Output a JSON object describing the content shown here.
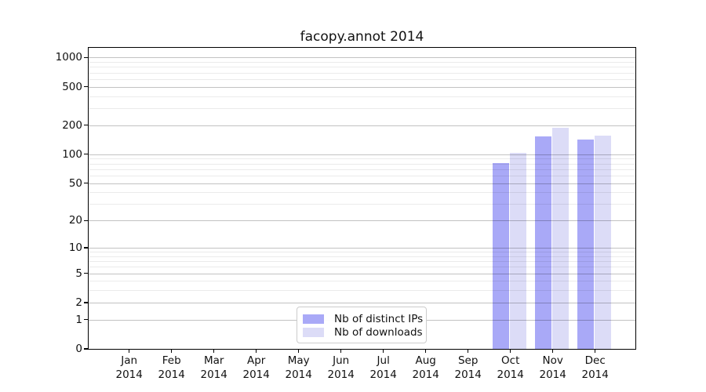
{
  "chart_data": {
    "type": "bar",
    "title": "facopy.annot 2014",
    "x_axis": {
      "categories": [
        {
          "month": "Jan",
          "year": "2014"
        },
        {
          "month": "Feb",
          "year": "2014"
        },
        {
          "month": "Mar",
          "year": "2014"
        },
        {
          "month": "Apr",
          "year": "2014"
        },
        {
          "month": "May",
          "year": "2014"
        },
        {
          "month": "Jun",
          "year": "2014"
        },
        {
          "month": "Jul",
          "year": "2014"
        },
        {
          "month": "Aug",
          "year": "2014"
        },
        {
          "month": "Sep",
          "year": "2014"
        },
        {
          "month": "Oct",
          "year": "2014"
        },
        {
          "month": "Nov",
          "year": "2014"
        },
        {
          "month": "Dec",
          "year": "2014"
        }
      ]
    },
    "y_axis": {
      "scale": "log1p",
      "ticks": [
        0,
        1,
        2,
        5,
        10,
        20,
        50,
        100,
        200,
        500,
        1000
      ],
      "minor_ticks": [
        3,
        4,
        6,
        7,
        8,
        9,
        30,
        40,
        60,
        70,
        80,
        90,
        300,
        400,
        600,
        700,
        800,
        900
      ],
      "range": [
        0,
        1260
      ],
      "grid": true
    },
    "series": [
      {
        "name": "Nb of distinct IPs",
        "color": "#a9a9f7",
        "values": [
          0,
          0,
          0,
          0,
          0,
          0,
          0,
          0,
          0,
          81,
          153,
          143
        ]
      },
      {
        "name": "Nb of downloads",
        "color": "#dcdcf7",
        "values": [
          0,
          0,
          0,
          0,
          0,
          0,
          0,
          0,
          0,
          104,
          187,
          156
        ]
      }
    ],
    "legend": {
      "position": "lower center"
    }
  }
}
